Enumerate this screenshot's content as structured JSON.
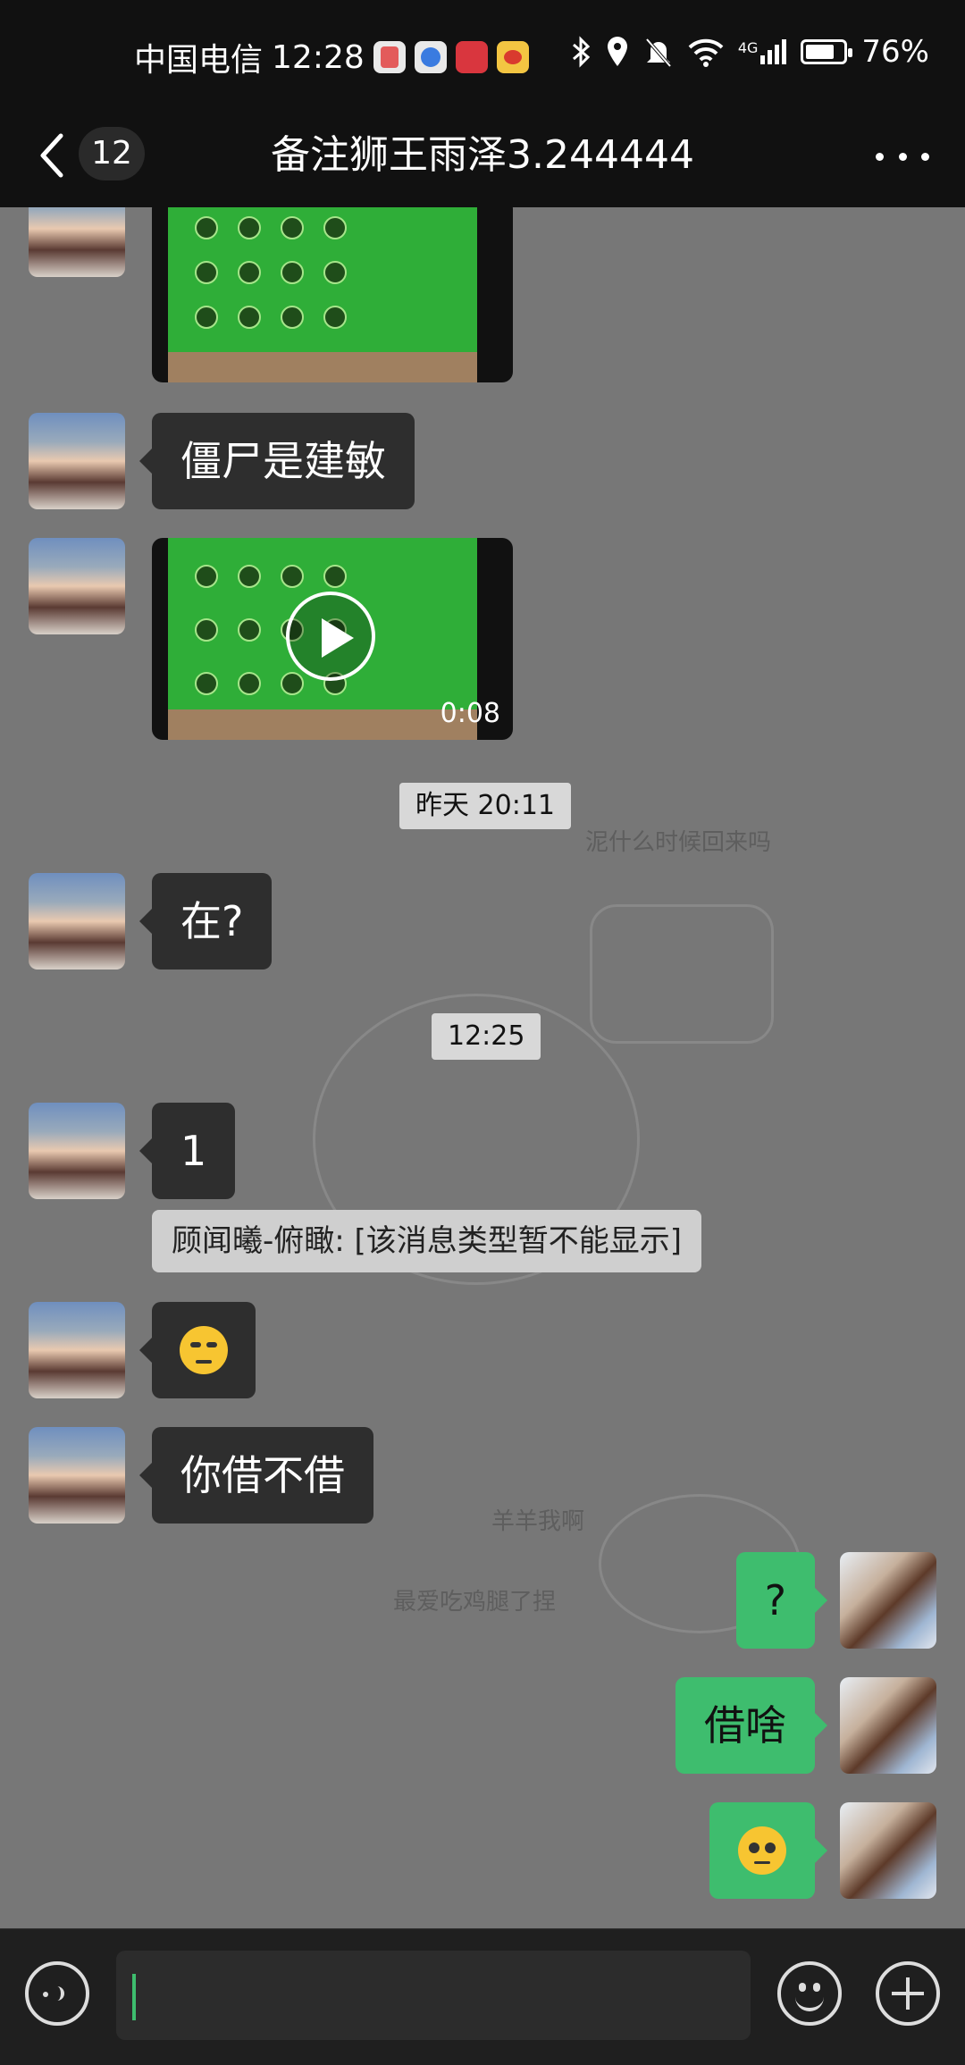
{
  "status_bar": {
    "carrier": "中国电信",
    "time": "12:28",
    "network": "4G",
    "battery": "76%",
    "battery_level": 0.76,
    "app_icons": [
      "app-red-icon",
      "app-blue-icon",
      "huawei-icon",
      "weibo-icon"
    ],
    "status_icons": [
      "bluetooth-icon",
      "location-icon",
      "mute-icon",
      "wifi-icon",
      "signal-icon"
    ]
  },
  "header": {
    "unread_count": "12",
    "title": "备注狮王雨泽3.244444"
  },
  "messages": {
    "m1_text": "僵尸是建敏",
    "video_duration": "0:08",
    "timestamp_1": "昨天 20:11",
    "m2_text": "在?",
    "timestamp_2": "12:25",
    "m3_text": "1",
    "system_message": "顾闻曦-俯瞰: [该消息类型暂不能显示]",
    "m4_emoji": "sweat-emoji",
    "m5_text": "你借不借",
    "m6_text": "?",
    "m7_text": "借啥",
    "m8_emoji": "pleading-emoji"
  },
  "wallpaper_text": {
    "t1": "泥什么时候回来吗",
    "t2": "羊羊我啊",
    "t3": "最爱吃鸡腿了捏"
  },
  "colors": {
    "sent_bubble": "#3ebd6e",
    "received_bubble": "#2e2e2e",
    "cursor": "#3ebd6e"
  }
}
